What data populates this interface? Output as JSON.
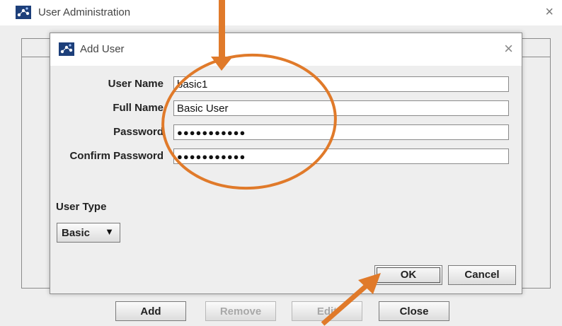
{
  "outer_window": {
    "title": "User Administration",
    "close_glyph": "×",
    "buttons": {
      "add": "Add",
      "remove": "Remove",
      "edit": "Edit",
      "close": "Close"
    }
  },
  "dialog": {
    "title": "Add User",
    "close_glyph": "×",
    "fields": {
      "user_name": {
        "label": "User Name",
        "value": "basic1"
      },
      "full_name": {
        "label": "Full Name",
        "value": "Basic User"
      },
      "password": {
        "label": "Password",
        "value": "●●●●●●●●●●●"
      },
      "confirm_password": {
        "label": "Confirm Password",
        "value": "●●●●●●●●●●●"
      }
    },
    "user_type": {
      "label": "User Type",
      "selected": "Basic",
      "arrow_glyph": "▼"
    },
    "buttons": {
      "ok": "OK",
      "cancel": "Cancel"
    }
  },
  "icons": {
    "app_icon": "network-nodes-icon",
    "dropdown_arrow": "chevron-down-icon"
  },
  "colors": {
    "annotation": "#e07a2a",
    "window_bg": "#eeeeee",
    "titlebar_bg": "#ffffff"
  }
}
